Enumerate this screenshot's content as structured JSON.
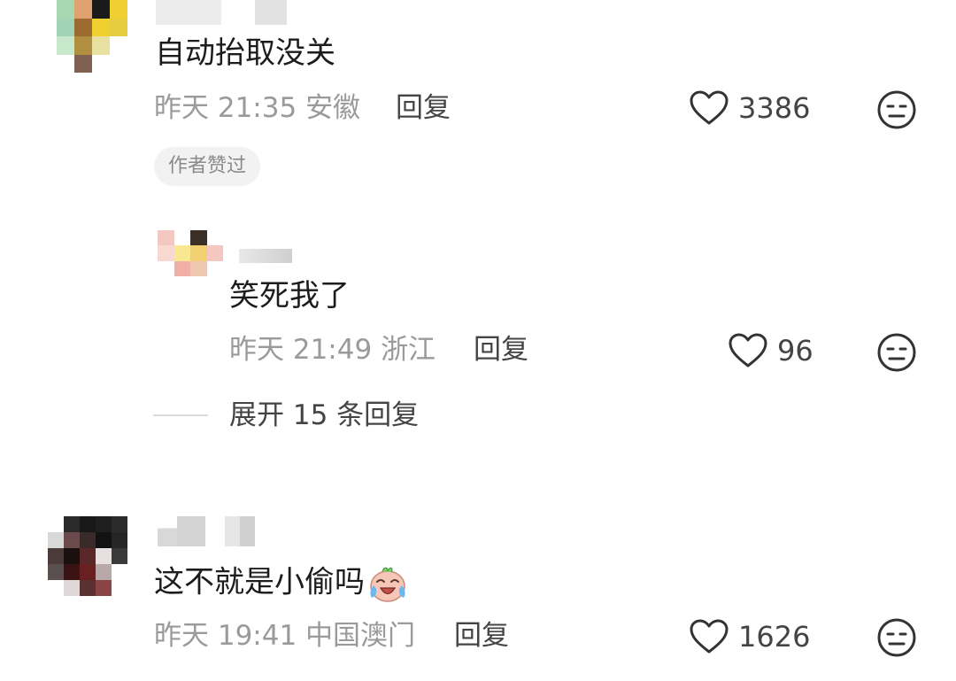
{
  "comments": [
    {
      "text": "自动抬取没关",
      "date": "昨天",
      "time": "21:35",
      "location": "安徽",
      "reply_label": "回复",
      "likes": "3386",
      "badge": "作者赞过"
    },
    {
      "text": "笑死我了",
      "date": "昨天",
      "time": "21:49",
      "location": "浙江",
      "reply_label": "回复",
      "likes": "96"
    },
    {
      "text": "这不就是小偷吗",
      "emoji": "crying-laughing-emoji",
      "date": "昨天",
      "time": "19:41",
      "location": "中国澳门",
      "reply_label": "回复",
      "likes": "1626"
    }
  ],
  "expand_replies": {
    "label": "展开 15 条回复"
  },
  "icons": {
    "like": "heart-outline-icon",
    "dislike": "neutral-face-icon"
  }
}
